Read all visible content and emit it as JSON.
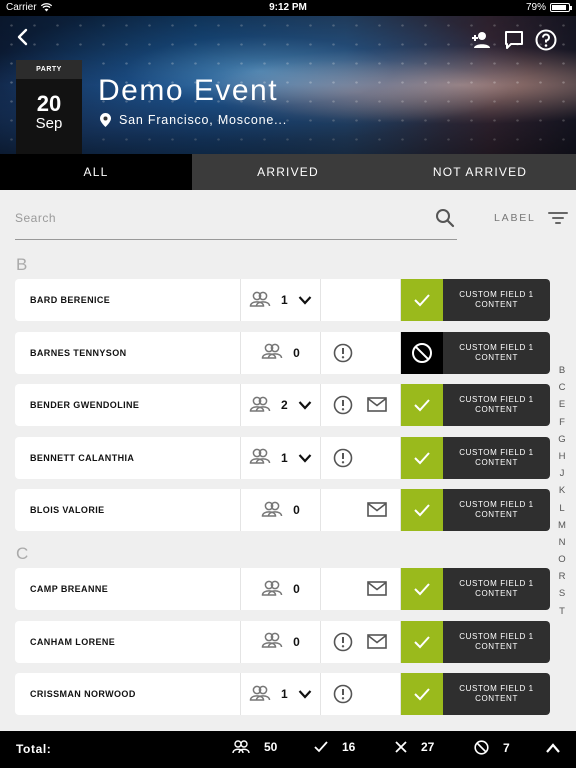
{
  "status_bar": {
    "carrier": "Carrier",
    "time": "9:12 PM",
    "battery": "79%"
  },
  "event": {
    "tag": "PARTY",
    "day": "20",
    "month": "Sep",
    "title": "Demo Event",
    "location": "San Francisco, Moscone..."
  },
  "tabs": [
    {
      "label": "ALL",
      "active": true
    },
    {
      "label": "ARRIVED",
      "active": false
    },
    {
      "label": "NOT ARRIVED",
      "active": false
    }
  ],
  "search": {
    "placeholder": "Search"
  },
  "filter": {
    "label": "LABEL"
  },
  "sections": [
    {
      "letter": "B",
      "guests": [
        {
          "name": "BARD BERENICE",
          "count": "1",
          "expandable": true,
          "alert": false,
          "mail": false,
          "status": "arrived",
          "custom_field": "CUSTOM FIELD 1 CONTENT"
        },
        {
          "name": "BARNES TENNYSON",
          "count": "0",
          "expandable": false,
          "alert": true,
          "mail": false,
          "status": "declined",
          "custom_field": "CUSTOM FIELD 1 CONTENT"
        },
        {
          "name": "BENDER GWENDOLINE",
          "count": "2",
          "expandable": true,
          "alert": true,
          "mail": true,
          "status": "arrived",
          "custom_field": "CUSTOM FIELD 1 CONTENT"
        },
        {
          "name": "BENNETT CALANTHIA",
          "count": "1",
          "expandable": true,
          "alert": true,
          "mail": false,
          "status": "arrived",
          "custom_field": "CUSTOM FIELD 1 CONTENT"
        },
        {
          "name": "BLOIS VALORIE",
          "count": "0",
          "expandable": false,
          "alert": false,
          "mail": true,
          "status": "arrived",
          "custom_field": "CUSTOM FIELD 1 CONTENT"
        }
      ]
    },
    {
      "letter": "C",
      "guests": [
        {
          "name": "CAMP BREANNE",
          "count": "0",
          "expandable": false,
          "alert": false,
          "mail": true,
          "status": "arrived",
          "custom_field": "CUSTOM FIELD 1 CONTENT"
        },
        {
          "name": "CANHAM LORENE",
          "count": "0",
          "expandable": false,
          "alert": true,
          "mail": true,
          "status": "arrived",
          "custom_field": "CUSTOM FIELD 1 CONTENT"
        },
        {
          "name": "CRISSMAN NORWOOD",
          "count": "1",
          "expandable": true,
          "alert": true,
          "mail": false,
          "status": "arrived",
          "custom_field": "CUSTOM FIELD 1 CONTENT"
        }
      ]
    }
  ],
  "index_letters": [
    "B",
    "C",
    "E",
    "F",
    "G",
    "H",
    "J",
    "K",
    "L",
    "M",
    "N",
    "O",
    "R",
    "S",
    "T"
  ],
  "footer": {
    "total_label": "Total:",
    "guests": "50",
    "arrived": "16",
    "not_arrived": "27",
    "declined": "7"
  },
  "colors": {
    "arrived_green": "#9aba1c",
    "dark": "#2f2f2f",
    "tab_inactive": "#3b3b3b"
  }
}
